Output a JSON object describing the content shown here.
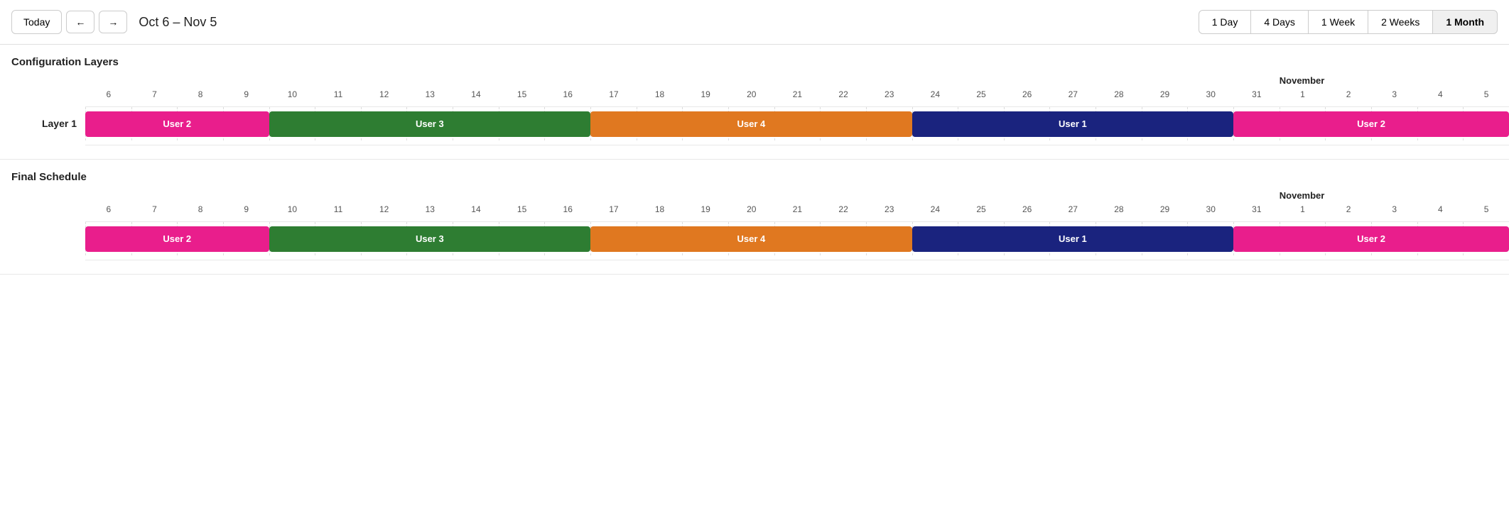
{
  "toolbar": {
    "today_label": "Today",
    "prev_label": "←",
    "next_label": "→",
    "date_range": "Oct 6 – Nov 5",
    "view_buttons": [
      {
        "label": "1 Day",
        "active": false
      },
      {
        "label": "4 Days",
        "active": false
      },
      {
        "label": "1 Week",
        "active": false
      },
      {
        "label": "2 Weeks",
        "active": false
      },
      {
        "label": "1 Month",
        "active": true
      }
    ]
  },
  "sections": [
    {
      "title": "Configuration Layers",
      "month_label": "November",
      "days": [
        6,
        7,
        8,
        9,
        10,
        11,
        12,
        13,
        14,
        15,
        16,
        17,
        18,
        19,
        20,
        21,
        22,
        23,
        24,
        25,
        26,
        27,
        28,
        29,
        30,
        31,
        1,
        2,
        3,
        4,
        5
      ],
      "rows": [
        {
          "label": "Layer 1",
          "bars": [
            {
              "label": "User 2",
              "color": "bar-pink",
              "start_day_index": 0,
              "span": 4
            },
            {
              "label": "User 3",
              "color": "bar-green",
              "start_day_index": 4,
              "span": 7
            },
            {
              "label": "User 4",
              "color": "bar-orange",
              "start_day_index": 11,
              "span": 7
            },
            {
              "label": "User 1",
              "color": "bar-navy",
              "start_day_index": 18,
              "span": 7
            },
            {
              "label": "User 2",
              "color": "bar-pink",
              "start_day_index": 25,
              "span": 6
            }
          ]
        }
      ]
    },
    {
      "title": "Final Schedule",
      "month_label": "November",
      "days": [
        6,
        7,
        8,
        9,
        10,
        11,
        12,
        13,
        14,
        15,
        16,
        17,
        18,
        19,
        20,
        21,
        22,
        23,
        24,
        25,
        26,
        27,
        28,
        29,
        30,
        31,
        1,
        2,
        3,
        4,
        5
      ],
      "rows": [
        {
          "label": "",
          "bars": [
            {
              "label": "User 2",
              "color": "bar-pink",
              "start_day_index": 0,
              "span": 4
            },
            {
              "label": "User 3",
              "color": "bar-green",
              "start_day_index": 4,
              "span": 7
            },
            {
              "label": "User 4",
              "color": "bar-orange",
              "start_day_index": 11,
              "span": 7
            },
            {
              "label": "User 1",
              "color": "bar-navy",
              "start_day_index": 18,
              "span": 7
            },
            {
              "label": "User 2",
              "color": "bar-pink",
              "start_day_index": 25,
              "span": 6
            }
          ]
        }
      ]
    }
  ],
  "november_start_index": 26
}
